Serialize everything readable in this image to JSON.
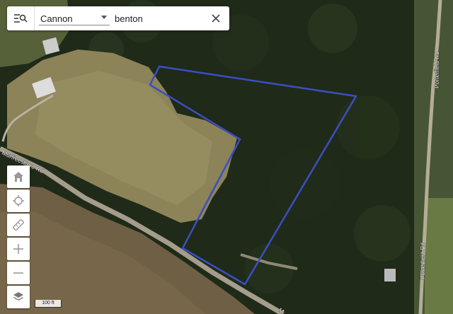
{
  "search": {
    "county": "Cannon",
    "query": "benton"
  },
  "map": {
    "roads": [
      "Porterfield Rd",
      "Porterfield Rd",
      "Murfreesboro Rd",
      "M"
    ],
    "parcel_color": "#3a4fc4",
    "scale_label": "100 ft"
  },
  "icons": {
    "menu": "menu-search-icon",
    "clear": "close-icon",
    "home": "home-icon",
    "locate": "crosshair-icon",
    "measure": "ruler-icon",
    "zoom_in": "plus-icon",
    "zoom_out": "minus-icon",
    "layers": "layers-icon"
  }
}
